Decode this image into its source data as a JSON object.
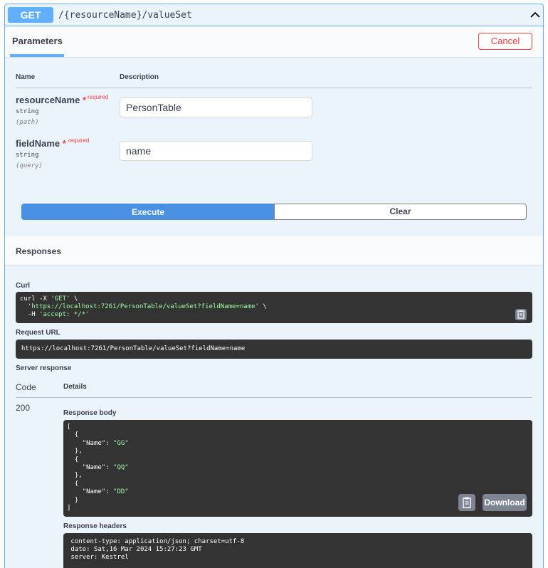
{
  "operation": {
    "method": "GET",
    "path": "/{resourceName}/valueSet"
  },
  "parameters": {
    "tab_label": "Parameters",
    "cancel_label": "Cancel",
    "col_name": "Name",
    "col_description": "Description",
    "required_text": "required",
    "items": [
      {
        "name": "resourceName",
        "type": "string",
        "in": "(path)",
        "value": "PersonTable"
      },
      {
        "name": "fieldName",
        "type": "string",
        "in": "(query)",
        "value": "name"
      }
    ]
  },
  "actions": {
    "execute_label": "Execute",
    "clear_label": "Clear"
  },
  "responses": {
    "title": "Responses",
    "curl_label": "Curl",
    "curl_lines": {
      "l1_cmd": "curl -X ",
      "l1_method": "'GET'",
      "l1_tail": " \\",
      "l2_url": "  'https://localhost:7261/PersonTable/valueSet?fieldName=name'",
      "l2_tail": " \\",
      "l3_flag": "  -H ",
      "l3_header": "'accept: */*'"
    },
    "request_url_label": "Request URL",
    "request_url": "https://localhost:7261/PersonTable/valueSet?fieldName=name",
    "server_response_label": "Server response",
    "code_header": "Code",
    "details_header": "Details",
    "code_value": "200",
    "body_label": "Response body",
    "body_lines": [
      {
        "pre": "[",
        "key": "",
        "mid": "",
        "val": "",
        "post": ""
      },
      {
        "pre": "  {",
        "key": "",
        "mid": "",
        "val": "",
        "post": ""
      },
      {
        "pre": "    ",
        "key": "\"Name\"",
        "mid": ": ",
        "val": "\"GG\"",
        "post": ""
      },
      {
        "pre": "  },",
        "key": "",
        "mid": "",
        "val": "",
        "post": ""
      },
      {
        "pre": "  {",
        "key": "",
        "mid": "",
        "val": "",
        "post": ""
      },
      {
        "pre": "    ",
        "key": "\"Name\"",
        "mid": ": ",
        "val": "\"QQ\"",
        "post": ""
      },
      {
        "pre": "  },",
        "key": "",
        "mid": "",
        "val": "",
        "post": ""
      },
      {
        "pre": "  {",
        "key": "",
        "mid": "",
        "val": "",
        "post": ""
      },
      {
        "pre": "    ",
        "key": "\"Name\"",
        "mid": ": ",
        "val": "\"DD\"",
        "post": ""
      },
      {
        "pre": "  }",
        "key": "",
        "mid": "",
        "val": "",
        "post": ""
      },
      {
        "pre": "]",
        "key": "",
        "mid": "",
        "val": "",
        "post": ""
      }
    ],
    "download_label": "Download",
    "headers_label": "Response headers",
    "header_lines": [
      " content-type: application/json; charset=utf-8",
      " date: Sat,16 Mar 2024 15:27:23 GMT",
      " server: Kestrel"
    ]
  },
  "icons": {
    "collapse": "chevron-up-icon",
    "copy": "clipboard-icon"
  }
}
